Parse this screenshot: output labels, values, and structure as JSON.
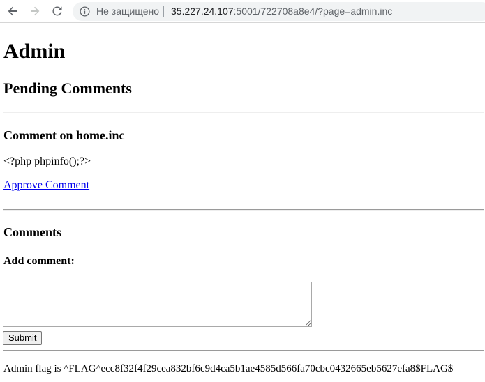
{
  "browser": {
    "security_label": "Не защищено",
    "url_host": "35.227.24.107",
    "url_rest": ":5001/722708a8e4/?page=admin.inc",
    "icons": {
      "back": "arrow-left-icon",
      "forward": "arrow-right-icon",
      "reload": "reload-icon",
      "info": "info-circle-icon"
    }
  },
  "page": {
    "title": "Admin",
    "pending_heading": "Pending Comments",
    "pending_comment": {
      "heading": "Comment on home.inc",
      "body": "<?php phpinfo();?>",
      "approve_label": "Approve Comment"
    },
    "comments_heading": "Comments",
    "add_comment_label": "Add comment:",
    "textarea_value": "",
    "submit_label": "Submit",
    "flag_text": "Admin flag is ^FLAG^ecc8f32f4f29cea832bf6c9d4ca5b1ae4585d566fa70cbc0432665eb5627efa8$FLAG$"
  },
  "colors": {
    "link": "#0000ee",
    "omnibox_bg": "#f1f3f4",
    "muted_text": "#5f6368"
  }
}
